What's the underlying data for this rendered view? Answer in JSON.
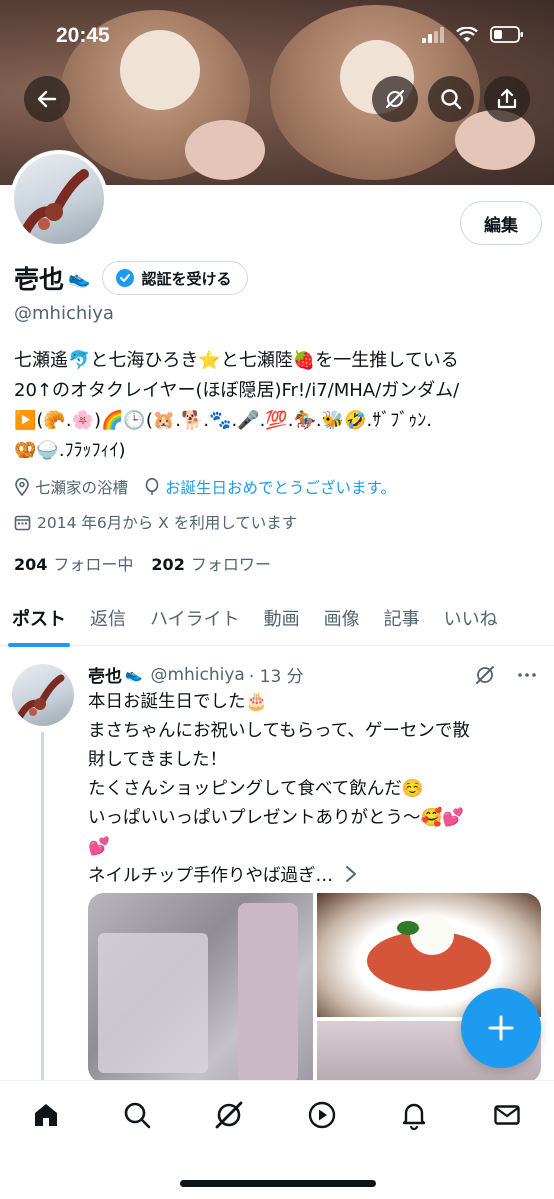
{
  "status_bar": {
    "time": "20:45"
  },
  "profile": {
    "display_name": "壱也",
    "verify_label": "認証を受ける",
    "edit_label": "編集",
    "handle": "@mhichiya",
    "bio_lines": [
      "七瀬遙🐬と七海ひろき⭐と七瀬陸🍓を一生推している",
      "20↑のオタクレイヤー(ほぼ隠居)Fr!/i7/MHA/ガンダム/",
      "▶️(🥐.🌸)🌈🕒(🐹.🐕.🐾.🎤.💯.🏇.🐝🤣.ｻﾞﾌﾞｩﾝ.",
      "🥨🍚.ﾌﾗｯﾌｨｲ)"
    ],
    "location": "七瀬家の浴槽",
    "website": "お誕生日おめでとうございます。",
    "joined": "2014 年6月から X を利用しています",
    "following_count": "204",
    "following_label": "フォロー中",
    "followers_count": "202",
    "followers_label": "フォロワー"
  },
  "tabs": [
    {
      "label": "ポスト",
      "active": true
    },
    {
      "label": "返信",
      "active": false
    },
    {
      "label": "ハイライト",
      "active": false
    },
    {
      "label": "動画",
      "active": false
    },
    {
      "label": "画像",
      "active": false
    },
    {
      "label": "記事",
      "active": false
    },
    {
      "label": "いいね",
      "active": false
    }
  ],
  "post": {
    "name": "壱也",
    "handle": "@mhichiya",
    "time": "· 13 分",
    "lines": [
      "本日お誕生日でした🎂",
      "まさちゃんにお祝いしてもらって、ゲーセンで散",
      "財してきました！",
      "たくさんショッピングして食べて飲んだ☺️",
      "いっぱいいっぱいプレゼントありがとう〜🥰💕",
      "💕",
      "ネイルチップ手作りやば過ぎ…"
    ],
    "more_label": "..."
  },
  "icons": {
    "back": "arrow-left-icon",
    "grok": "grok-icon",
    "search": "search-icon",
    "share": "share-icon",
    "compose": "plus-icon"
  },
  "colors": {
    "accent": "#1d9bf0",
    "text": "#0f1419",
    "muted": "#536471"
  }
}
